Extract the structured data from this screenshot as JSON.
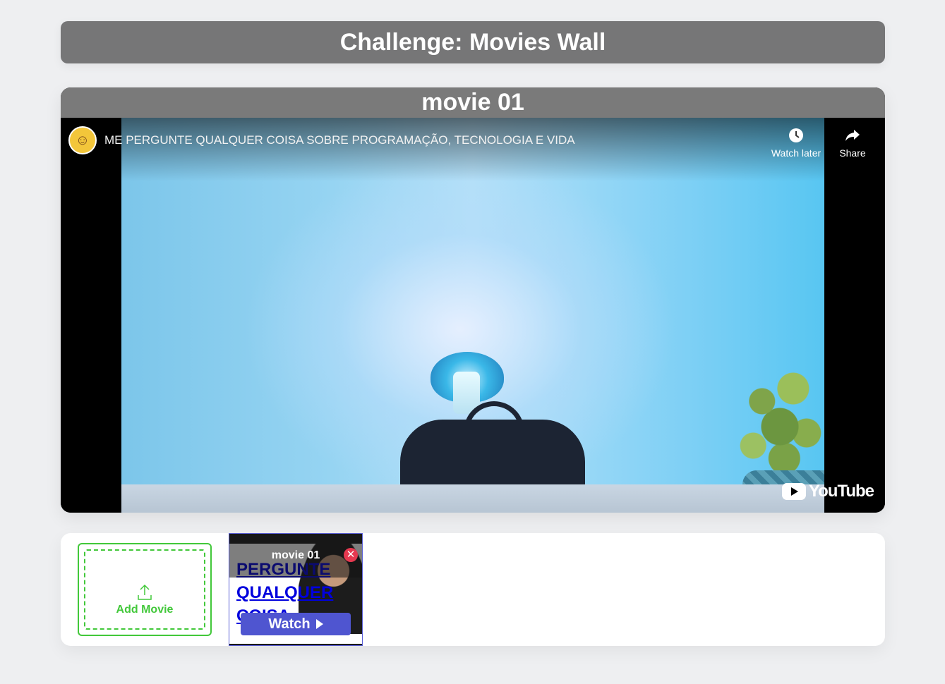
{
  "header": {
    "title": "Challenge: Movies Wall"
  },
  "player": {
    "title": "movie 01",
    "video_title": "ME PERGUNTE QUALQUER COISA SOBRE PROGRAMAÇÃO, TECNOLOGIA E VIDA",
    "watch_later_label": "Watch later",
    "share_label": "Share",
    "youtube_logo": "YouTube"
  },
  "gallery": {
    "add_movie_label": "Add Movie",
    "items": [
      {
        "label": "movie 01",
        "thumb_text": [
          "PERGUNTE",
          "QUALQUER",
          "COISA"
        ],
        "watch_label": "Watch",
        "close_symbol": "✕"
      }
    ]
  },
  "colors": {
    "background": "#eeeff1",
    "header_bg": "#767677",
    "accent_green": "#42c83a",
    "watch_button": "#4f55d0",
    "close_red": "#e63950"
  },
  "icons": [
    "clock-icon",
    "share-arrow-icon",
    "youtube-play-icon",
    "upload-icon",
    "play-triangle-icon",
    "close-icon"
  ]
}
